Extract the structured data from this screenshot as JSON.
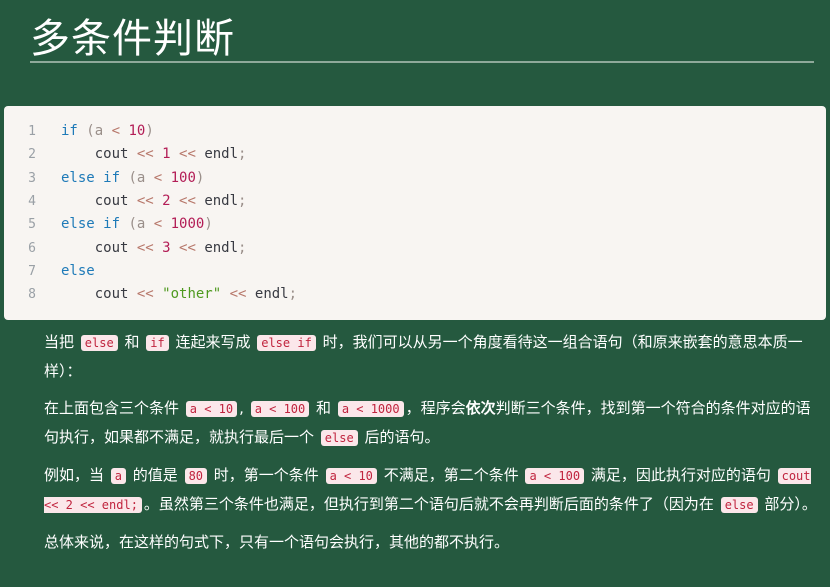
{
  "title": "多条件判断",
  "code": {
    "lines": [
      {
        "n": "1",
        "parts": [
          {
            "t": "if",
            "c": "kw"
          },
          {
            "t": " (a ",
            "c": "pn"
          },
          {
            "t": "<",
            "c": "op"
          },
          {
            "t": " ",
            "c": "pn"
          },
          {
            "t": "10",
            "c": "num"
          },
          {
            "t": ")",
            "c": "pn"
          }
        ]
      },
      {
        "n": "2",
        "parts": [
          {
            "t": "    cout ",
            "c": ""
          },
          {
            "t": "<<",
            "c": "op"
          },
          {
            "t": " ",
            "c": ""
          },
          {
            "t": "1",
            "c": "num"
          },
          {
            "t": " ",
            "c": ""
          },
          {
            "t": "<<",
            "c": "op"
          },
          {
            "t": " endl",
            "c": ""
          },
          {
            "t": ";",
            "c": "pn"
          }
        ]
      },
      {
        "n": "3",
        "parts": [
          {
            "t": "else",
            "c": "kw"
          },
          {
            "t": " ",
            "c": ""
          },
          {
            "t": "if",
            "c": "kw"
          },
          {
            "t": " (a ",
            "c": "pn"
          },
          {
            "t": "<",
            "c": "op"
          },
          {
            "t": " ",
            "c": "pn"
          },
          {
            "t": "100",
            "c": "num"
          },
          {
            "t": ")",
            "c": "pn"
          }
        ]
      },
      {
        "n": "4",
        "parts": [
          {
            "t": "    cout ",
            "c": ""
          },
          {
            "t": "<<",
            "c": "op"
          },
          {
            "t": " ",
            "c": ""
          },
          {
            "t": "2",
            "c": "num"
          },
          {
            "t": " ",
            "c": ""
          },
          {
            "t": "<<",
            "c": "op"
          },
          {
            "t": " endl",
            "c": ""
          },
          {
            "t": ";",
            "c": "pn"
          }
        ]
      },
      {
        "n": "5",
        "parts": [
          {
            "t": "else",
            "c": "kw"
          },
          {
            "t": " ",
            "c": ""
          },
          {
            "t": "if",
            "c": "kw"
          },
          {
            "t": " (a ",
            "c": "pn"
          },
          {
            "t": "<",
            "c": "op"
          },
          {
            "t": " ",
            "c": "pn"
          },
          {
            "t": "1000",
            "c": "num"
          },
          {
            "t": ")",
            "c": "pn"
          }
        ]
      },
      {
        "n": "6",
        "parts": [
          {
            "t": "    cout ",
            "c": ""
          },
          {
            "t": "<<",
            "c": "op"
          },
          {
            "t": " ",
            "c": ""
          },
          {
            "t": "3",
            "c": "num"
          },
          {
            "t": " ",
            "c": ""
          },
          {
            "t": "<<",
            "c": "op"
          },
          {
            "t": " endl",
            "c": ""
          },
          {
            "t": ";",
            "c": "pn"
          }
        ]
      },
      {
        "n": "7",
        "parts": [
          {
            "t": "else",
            "c": "kw"
          }
        ]
      },
      {
        "n": "8",
        "parts": [
          {
            "t": "    cout ",
            "c": ""
          },
          {
            "t": "<<",
            "c": "op"
          },
          {
            "t": " ",
            "c": ""
          },
          {
            "t": "\"other\"",
            "c": "str"
          },
          {
            "t": " ",
            "c": ""
          },
          {
            "t": "<<",
            "c": "op"
          },
          {
            "t": " endl",
            "c": ""
          },
          {
            "t": ";",
            "c": "pn"
          }
        ]
      }
    ]
  },
  "paragraphs": [
    {
      "parts": [
        {
          "t": "当把 "
        },
        {
          "t": "else",
          "code": true
        },
        {
          "t": " 和 "
        },
        {
          "t": "if",
          "code": true
        },
        {
          "t": " 连起来写成 "
        },
        {
          "t": "else if",
          "code": true
        },
        {
          "t": " 时，我们可以从另一个角度看待这一组合语句（和原来嵌套的意思本质一样）："
        }
      ]
    },
    {
      "parts": [
        {
          "t": "在上面包含三个条件 "
        },
        {
          "t": "a < 10",
          "code": true
        },
        {
          "t": ", "
        },
        {
          "t": "a < 100",
          "code": true
        },
        {
          "t": " 和 "
        },
        {
          "t": "a < 1000",
          "code": true
        },
        {
          "t": "，程序会"
        },
        {
          "t": "依次",
          "bold": true
        },
        {
          "t": "判断三个条件，找到第一个符合的条件对应的语句执行，如果都不满足，就执行最后一个 "
        },
        {
          "t": "else",
          "code": true
        },
        {
          "t": " 后的语句。"
        }
      ]
    },
    {
      "parts": [
        {
          "t": "例如，当 "
        },
        {
          "t": "a",
          "code": true
        },
        {
          "t": " 的值是 "
        },
        {
          "t": "80",
          "code": true
        },
        {
          "t": " 时，第一个条件 "
        },
        {
          "t": "a < 10",
          "code": true
        },
        {
          "t": " 不满足，第二个条件 "
        },
        {
          "t": "a < 100",
          "code": true
        },
        {
          "t": " 满足，因此执行对应的语句 "
        },
        {
          "t": "cout << 2 << endl;",
          "code": true
        },
        {
          "t": "。虽然第三个条件也满足，但执行到第二个语句后就不会再判断后面的条件了（因为在 "
        },
        {
          "t": "else",
          "code": true
        },
        {
          "t": " 部分）。"
        }
      ]
    },
    {
      "parts": [
        {
          "t": "总体来说，在这样的句式下，只有一个语句会执行，其他的都不执行。"
        }
      ]
    }
  ]
}
